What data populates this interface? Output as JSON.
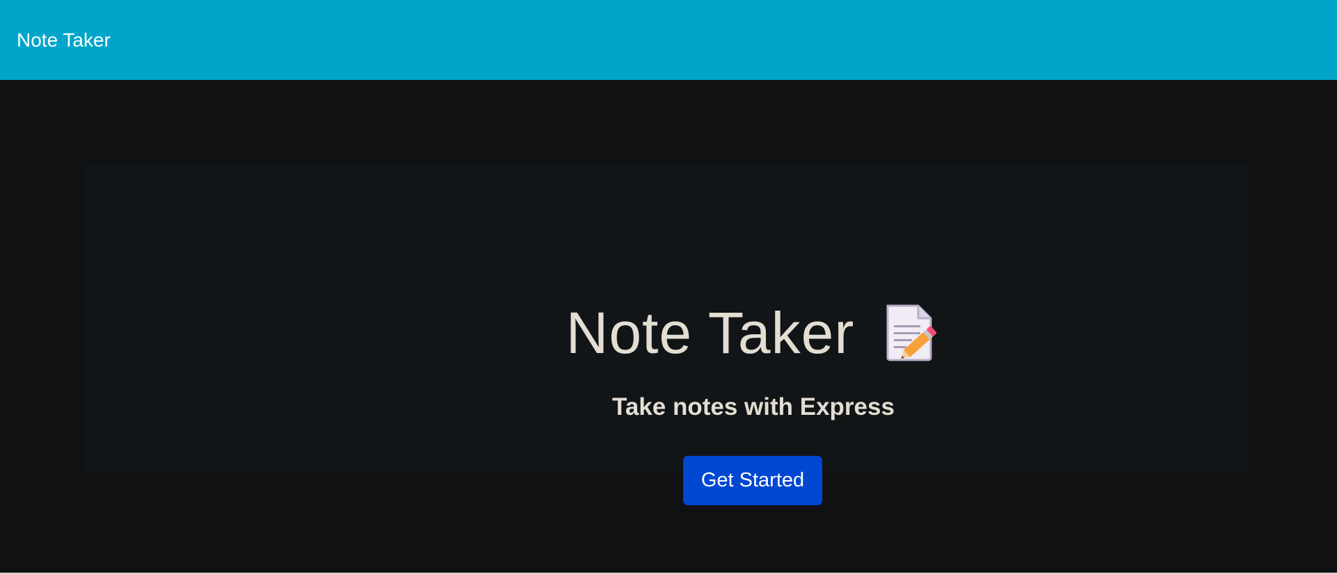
{
  "navbar": {
    "brand": "Note Taker"
  },
  "hero": {
    "title": "Note Taker",
    "icon": "memo-icon",
    "subtitle": "Take notes with Express",
    "cta_label": "Get Started"
  },
  "colors": {
    "navbar_bg": "#00a5c9",
    "page_bg": "#101113",
    "jumbotron_bg": "#121517",
    "text": "#e3ddd2",
    "button_bg": "#0047d2"
  }
}
